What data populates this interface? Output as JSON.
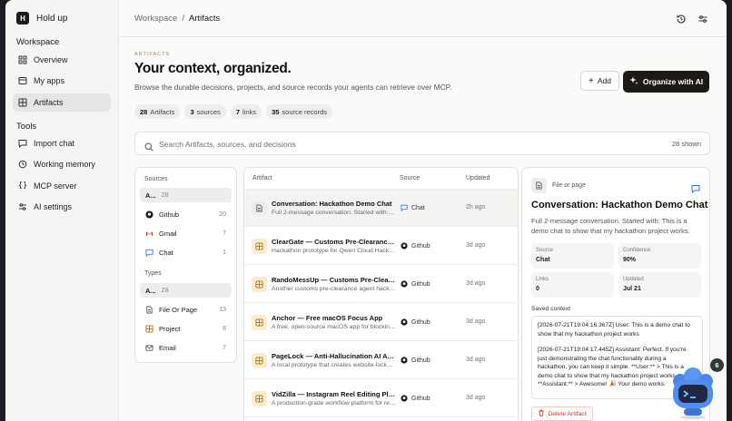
{
  "sidebar": {
    "brand_initial": "H",
    "brand_name": "Hold up",
    "workspace_title": "Workspace",
    "workspace_items": [
      {
        "label": "Overview",
        "icon": "grid-icon"
      },
      {
        "label": "My apps",
        "icon": "app-icon"
      },
      {
        "label": "Artifacts",
        "icon": "layers-icon",
        "active": true
      }
    ],
    "tools_title": "Tools",
    "tools_items": [
      {
        "label": "Import chat",
        "icon": "chat-icon"
      },
      {
        "label": "Working memory",
        "icon": "history-icon"
      },
      {
        "label": "MCP server",
        "icon": "braces-icon"
      },
      {
        "label": "AI settings",
        "icon": "sliders-icon"
      }
    ]
  },
  "topbar": {
    "crumb_root": "Workspace",
    "crumb_sep": "/",
    "crumb_current": "Artifacts"
  },
  "header": {
    "eyebrow": "ARTIFACTS",
    "title": "Your context, organized.",
    "subtitle": "Browse the durable decisions, projects, and source records your agents can retrieve over MCP.",
    "add_label": "Add",
    "organize_label": "Organize with AI"
  },
  "stats": [
    {
      "num": "28",
      "label": "Artifacts"
    },
    {
      "num": "3",
      "label": "sources"
    },
    {
      "num": "7",
      "label": "links"
    },
    {
      "num": "35",
      "label": "source records"
    }
  ],
  "search": {
    "placeholder": "Search Artifacts, sources, and decisions",
    "shown": "28 shown"
  },
  "filters": {
    "sources_title": "Sources",
    "sources": [
      {
        "label": "A...",
        "count": "28",
        "selected": true
      },
      {
        "label": "Github",
        "count": "20",
        "icon": "github-icon"
      },
      {
        "label": "Gmail",
        "count": "7",
        "icon": "gmail-icon"
      },
      {
        "label": "Chat",
        "count": "1",
        "icon": "chat-icon"
      }
    ],
    "types_title": "Types",
    "types": [
      {
        "label": "A...",
        "count": "28",
        "selected": true
      },
      {
        "label": "File Or Page",
        "count": "13",
        "icon": "file-icon"
      },
      {
        "label": "Project",
        "count": "8",
        "icon": "project-icon"
      },
      {
        "label": "Email",
        "count": "7",
        "icon": "mail-icon"
      }
    ]
  },
  "table": {
    "col_artifact": "Artifact",
    "col_source": "Source",
    "col_updated": "Updated",
    "rows": [
      {
        "title": "Conversation: Hackathon Demo Chat",
        "desc": "Full 2-message conversation. Started with: This is a demo chat",
        "source": "Chat",
        "updated": "2h ago",
        "kind": "file"
      },
      {
        "title": "ClearGate — Customs Pre-Clearance Agent",
        "desc": "Hackathon prototype for Qwen Cloud Hackathon",
        "source": "Github",
        "updated": "3d ago",
        "kind": "project"
      },
      {
        "title": "RandoMessUp — Customs Pre-Clearance Agent",
        "desc": "Another customs pre-clearance agent hackathon build",
        "source": "Github",
        "updated": "3d ago",
        "kind": "project"
      },
      {
        "title": "Anchor — Free macOS Focus App",
        "desc": "A free, open-source macOS app for blocking distractions",
        "source": "Github",
        "updated": "3d ago",
        "kind": "project"
      },
      {
        "title": "PageLock — Anti-Hallucination AI Assistant",
        "desc": "A local prototype that creates website-locked assistants",
        "source": "Github",
        "updated": "3d ago",
        "kind": "project"
      },
      {
        "title": "VidZilla — Instagram Reel Editing Platform",
        "desc": "A production-grade workflow platform for reels",
        "source": "Github",
        "updated": "3d ago",
        "kind": "project"
      }
    ]
  },
  "detail": {
    "kind": "File or page",
    "title": "Conversation: Hackathon Demo Chat",
    "desc": "Full 2-message conversation. Started with: This is a demo chat to show that my hackathon project works.",
    "meta": [
      {
        "key": "Source",
        "value": "Chat"
      },
      {
        "key": "Confidence",
        "value": "90%"
      },
      {
        "key": "Links",
        "value": "0"
      },
      {
        "key": "Updated",
        "value": "Jul 21"
      }
    ],
    "saved_title": "Saved context",
    "ctx_1": "[2026-07-21T19:04:16.367Z] User: This is a demo chat to show that my hackathon project works",
    "ctx_2": "[2026-07-21T19:04:17.445Z] Assistant: Perfect. If you're just demonstrating the chat functionality during a hackathon, you can keep it simple. **User:** > This is a demo chat to show that my hackathon project works **Assistant:** > Awesome! 🎉 Your demo works.",
    "delete_label": "Delete Artifact"
  },
  "mascot": {
    "badge": "6"
  },
  "colors": {
    "accent_dark": "#1c1917",
    "project_tile": "#fbeccb",
    "eyebrow": "#b07d3a",
    "chat_blue": "#3b6fe0",
    "danger": "#c0392b"
  }
}
